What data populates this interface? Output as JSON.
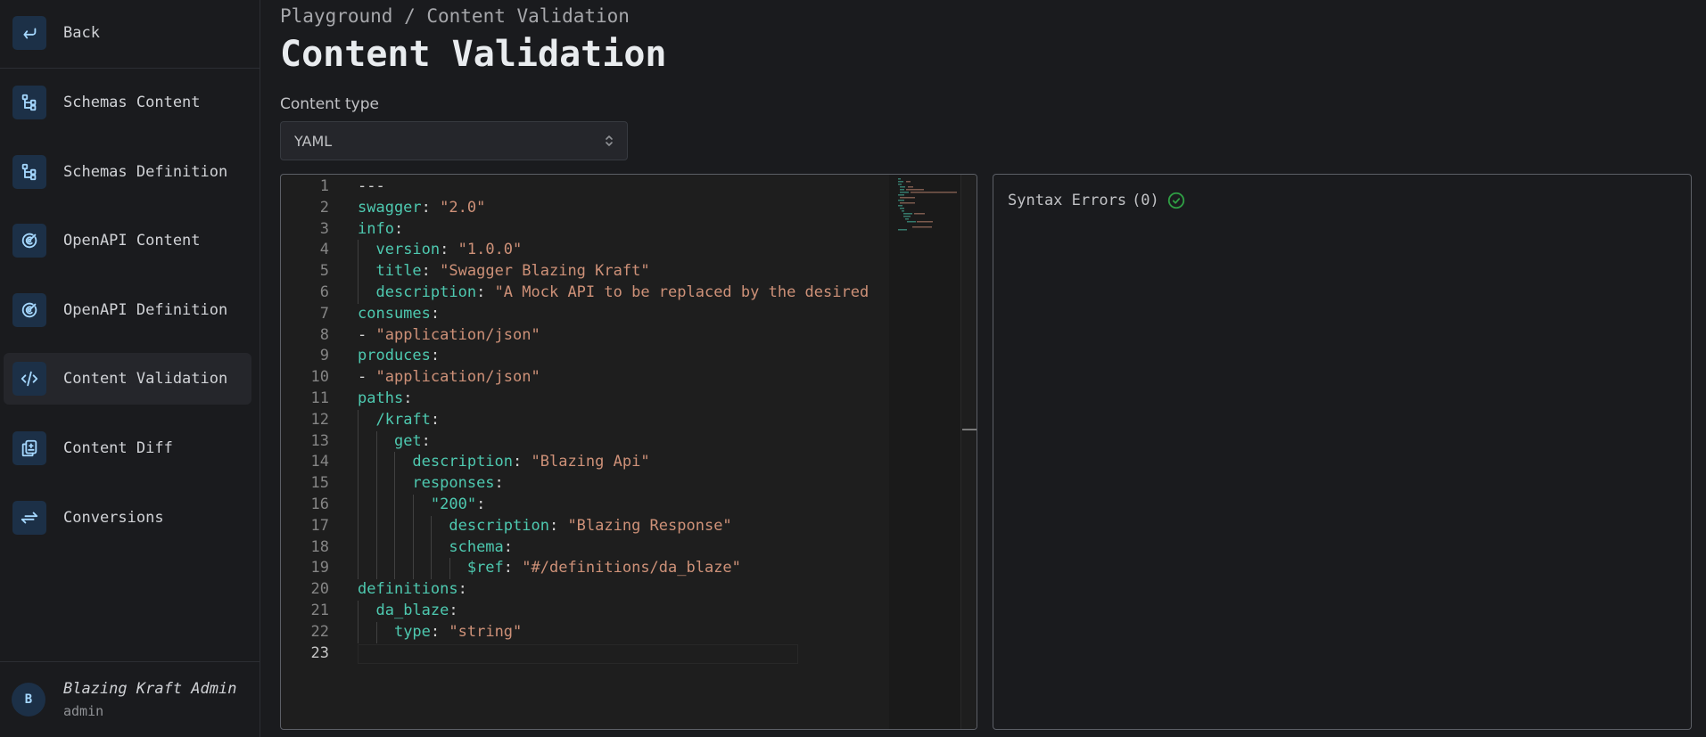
{
  "sidebar": {
    "back_label": "Back",
    "items": [
      {
        "label": "Schemas Content",
        "icon": "schema-icon"
      },
      {
        "label": "Schemas Definition",
        "icon": "schema-icon"
      },
      {
        "label": "OpenAPI Content",
        "icon": "api-icon"
      },
      {
        "label": "OpenAPI Definition",
        "icon": "api-icon"
      },
      {
        "label": "Content Validation",
        "icon": "code-icon",
        "active": true
      },
      {
        "label": "Content Diff",
        "icon": "diff-icon"
      },
      {
        "label": "Conversions",
        "icon": "arrows-exchange-icon"
      }
    ],
    "user": {
      "initial": "B",
      "name": "Blazing Kraft Admin",
      "role": "admin"
    }
  },
  "header": {
    "breadcrumb": "Playground / Content Validation",
    "title": "Content Validation"
  },
  "content_type": {
    "label": "Content type",
    "value": "YAML"
  },
  "editor": {
    "current_line": 23,
    "lines": [
      {
        "n": "1",
        "t": [
          [
            "p",
            "---"
          ]
        ]
      },
      {
        "n": "2",
        "t": [
          [
            "k",
            "swagger"
          ],
          [
            "p",
            ": "
          ],
          [
            "s",
            "\"2.0\""
          ]
        ]
      },
      {
        "n": "3",
        "t": [
          [
            "k",
            "info"
          ],
          [
            "p",
            ":"
          ]
        ]
      },
      {
        "n": "4",
        "t": [
          [
            "p",
            "  "
          ],
          [
            "k",
            "version"
          ],
          [
            "p",
            ": "
          ],
          [
            "s",
            "\"1.0.0\""
          ]
        ]
      },
      {
        "n": "5",
        "t": [
          [
            "p",
            "  "
          ],
          [
            "k",
            "title"
          ],
          [
            "p",
            ": "
          ],
          [
            "s",
            "\"Swagger Blazing Kraft\""
          ]
        ]
      },
      {
        "n": "6",
        "t": [
          [
            "p",
            "  "
          ],
          [
            "k",
            "description"
          ],
          [
            "p",
            ": "
          ],
          [
            "s",
            "\"A Mock API to be replaced by the desired"
          ]
        ]
      },
      {
        "n": "7",
        "t": [
          [
            "k",
            "consumes"
          ],
          [
            "p",
            ":"
          ]
        ]
      },
      {
        "n": "8",
        "t": [
          [
            "p",
            "- "
          ],
          [
            "s",
            "\"application/json\""
          ]
        ]
      },
      {
        "n": "9",
        "t": [
          [
            "k",
            "produces"
          ],
          [
            "p",
            ":"
          ]
        ]
      },
      {
        "n": "10",
        "t": [
          [
            "p",
            "- "
          ],
          [
            "s",
            "\"application/json\""
          ]
        ]
      },
      {
        "n": "11",
        "t": [
          [
            "k",
            "paths"
          ],
          [
            "p",
            ":"
          ]
        ]
      },
      {
        "n": "12",
        "t": [
          [
            "p",
            "  "
          ],
          [
            "k",
            "/kraft"
          ],
          [
            "p",
            ":"
          ]
        ]
      },
      {
        "n": "13",
        "t": [
          [
            "p",
            "    "
          ],
          [
            "k",
            "get"
          ],
          [
            "p",
            ":"
          ]
        ]
      },
      {
        "n": "14",
        "t": [
          [
            "p",
            "      "
          ],
          [
            "k",
            "description"
          ],
          [
            "p",
            ": "
          ],
          [
            "s",
            "\"Blazing Api\""
          ]
        ]
      },
      {
        "n": "15",
        "t": [
          [
            "p",
            "      "
          ],
          [
            "k",
            "responses"
          ],
          [
            "p",
            ":"
          ]
        ]
      },
      {
        "n": "16",
        "t": [
          [
            "p",
            "        "
          ],
          [
            "k",
            "\"200\""
          ],
          [
            "p",
            ":"
          ]
        ]
      },
      {
        "n": "17",
        "t": [
          [
            "p",
            "          "
          ],
          [
            "k",
            "description"
          ],
          [
            "p",
            ": "
          ],
          [
            "s",
            "\"Blazing Response\""
          ]
        ]
      },
      {
        "n": "18",
        "t": [
          [
            "p",
            "          "
          ],
          [
            "k",
            "schema"
          ],
          [
            "p",
            ":"
          ]
        ]
      },
      {
        "n": "19",
        "t": [
          [
            "p",
            "            "
          ],
          [
            "k",
            "$ref"
          ],
          [
            "p",
            ": "
          ],
          [
            "s",
            "\"#/definitions/da_blaze\""
          ]
        ]
      },
      {
        "n": "20",
        "t": [
          [
            "k",
            "definitions"
          ],
          [
            "p",
            ":"
          ]
        ]
      },
      {
        "n": "21",
        "t": [
          [
            "p",
            "  "
          ],
          [
            "k",
            "da_blaze"
          ],
          [
            "p",
            ":"
          ]
        ]
      },
      {
        "n": "22",
        "t": [
          [
            "p",
            "    "
          ],
          [
            "k",
            "type"
          ],
          [
            "p",
            ": "
          ],
          [
            "s",
            "\"string\""
          ]
        ]
      },
      {
        "n": "23",
        "t": []
      }
    ]
  },
  "errors": {
    "label": "Syntax Errors",
    "count": "(0)",
    "status_color": "#2f9e44"
  }
}
